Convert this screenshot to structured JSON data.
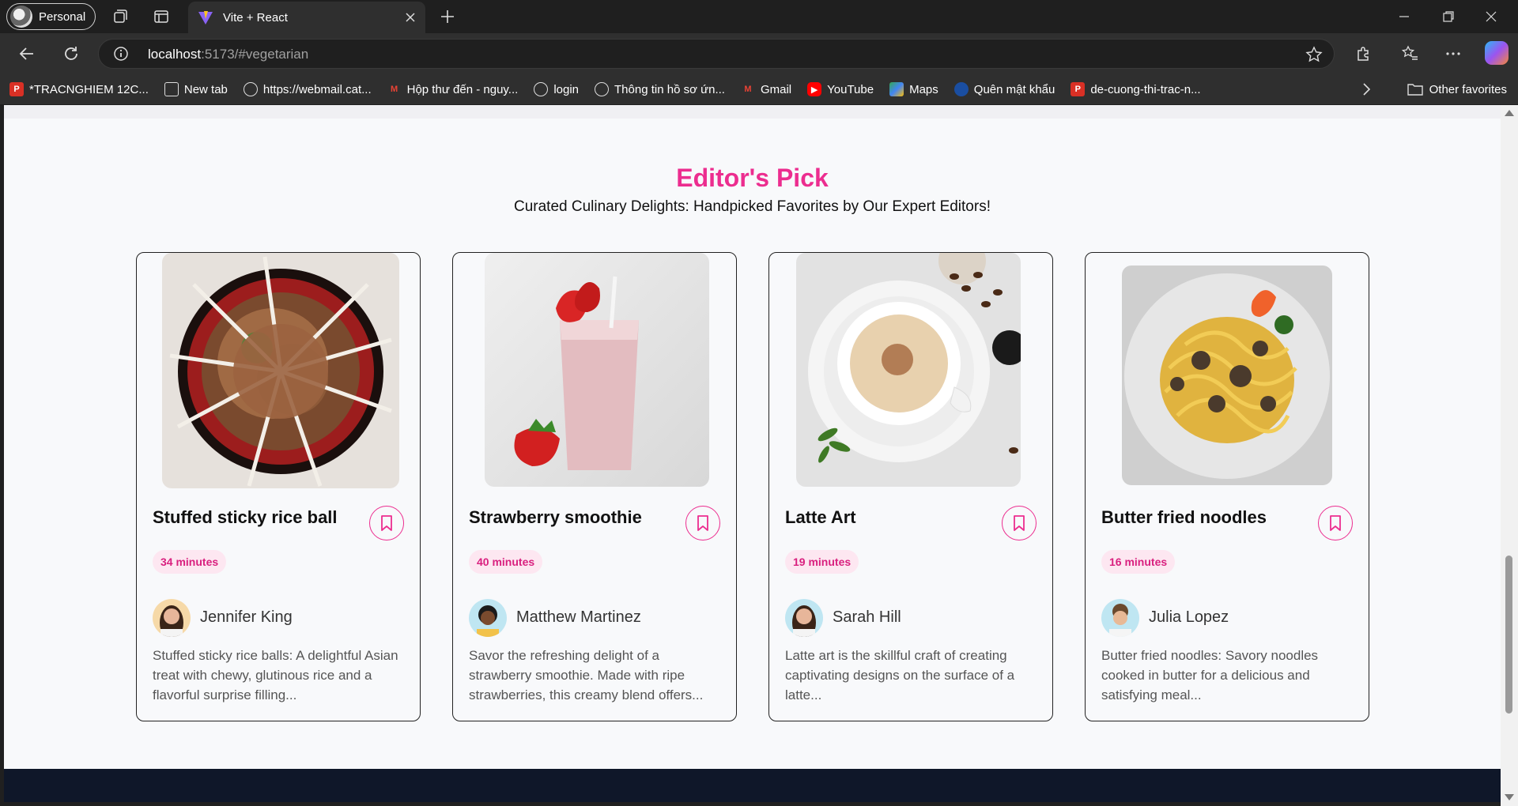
{
  "browser": {
    "profile_label": "Personal",
    "tab_title": "Vite + React",
    "url_host": "localhost",
    "url_rest": ":5173/#vegetarian",
    "bookmarks": [
      {
        "label": "*TRACNGHIEM 12C...",
        "icon": "pdf-icon",
        "color": "#d93025"
      },
      {
        "label": "New tab",
        "icon": "newtab-icon",
        "color": "#5f6368"
      },
      {
        "label": "https://webmail.cat...",
        "icon": "globe-icon",
        "color": "#5f6368"
      },
      {
        "label": "Hộp thư đến - nguy...",
        "icon": "gmail-icon",
        "color": "#ea4335"
      },
      {
        "label": "login",
        "icon": "globe-icon",
        "color": "#5f6368"
      },
      {
        "label": "Thông tin hồ sơ ứn...",
        "icon": "globe-icon",
        "color": "#5f6368"
      },
      {
        "label": "Gmail",
        "icon": "gmail-icon",
        "color": "#ea4335"
      },
      {
        "label": "YouTube",
        "icon": "youtube-icon",
        "color": "#ff0000"
      },
      {
        "label": "Maps",
        "icon": "maps-icon",
        "color": "#34a853"
      },
      {
        "label": "Quên mật khẩu",
        "icon": "shield-icon",
        "color": "#1a4ea1"
      },
      {
        "label": "de-cuong-thi-trac-n...",
        "icon": "pdf-icon",
        "color": "#d93025"
      }
    ],
    "other_favorites": "Other favorites"
  },
  "page": {
    "title": "Editor's Pick",
    "subtitle": "Curated Culinary Delights: Handpicked Favorites by Our Expert Editors!",
    "cards": [
      {
        "name": "Stuffed sticky rice ball",
        "time": "34 minutes",
        "author": "Jennifer King",
        "description": "Stuffed sticky rice balls: A delightful Asian treat with chewy, glutinous rice and a flavorful surprise filling..."
      },
      {
        "name": "Strawberry smoothie",
        "time": "40 minutes",
        "author": "Matthew Martinez",
        "description": "Savor the refreshing delight of a strawberry smoothie. Made with ripe strawberries, this creamy blend offers..."
      },
      {
        "name": "Latte Art",
        "time": "19 minutes",
        "author": "Sarah Hill",
        "description": "Latte art is the skillful craft of creating captivating designs on the surface of a latte..."
      },
      {
        "name": "Butter fried noodles",
        "time": "16 minutes",
        "author": "Julia Lopez",
        "description": "Butter fried noodles: Savory noodles cooked in butter for a delicious and satisfying meal..."
      }
    ]
  },
  "colors": {
    "accent": "#ec2d8f",
    "footer": "#0f1729"
  }
}
